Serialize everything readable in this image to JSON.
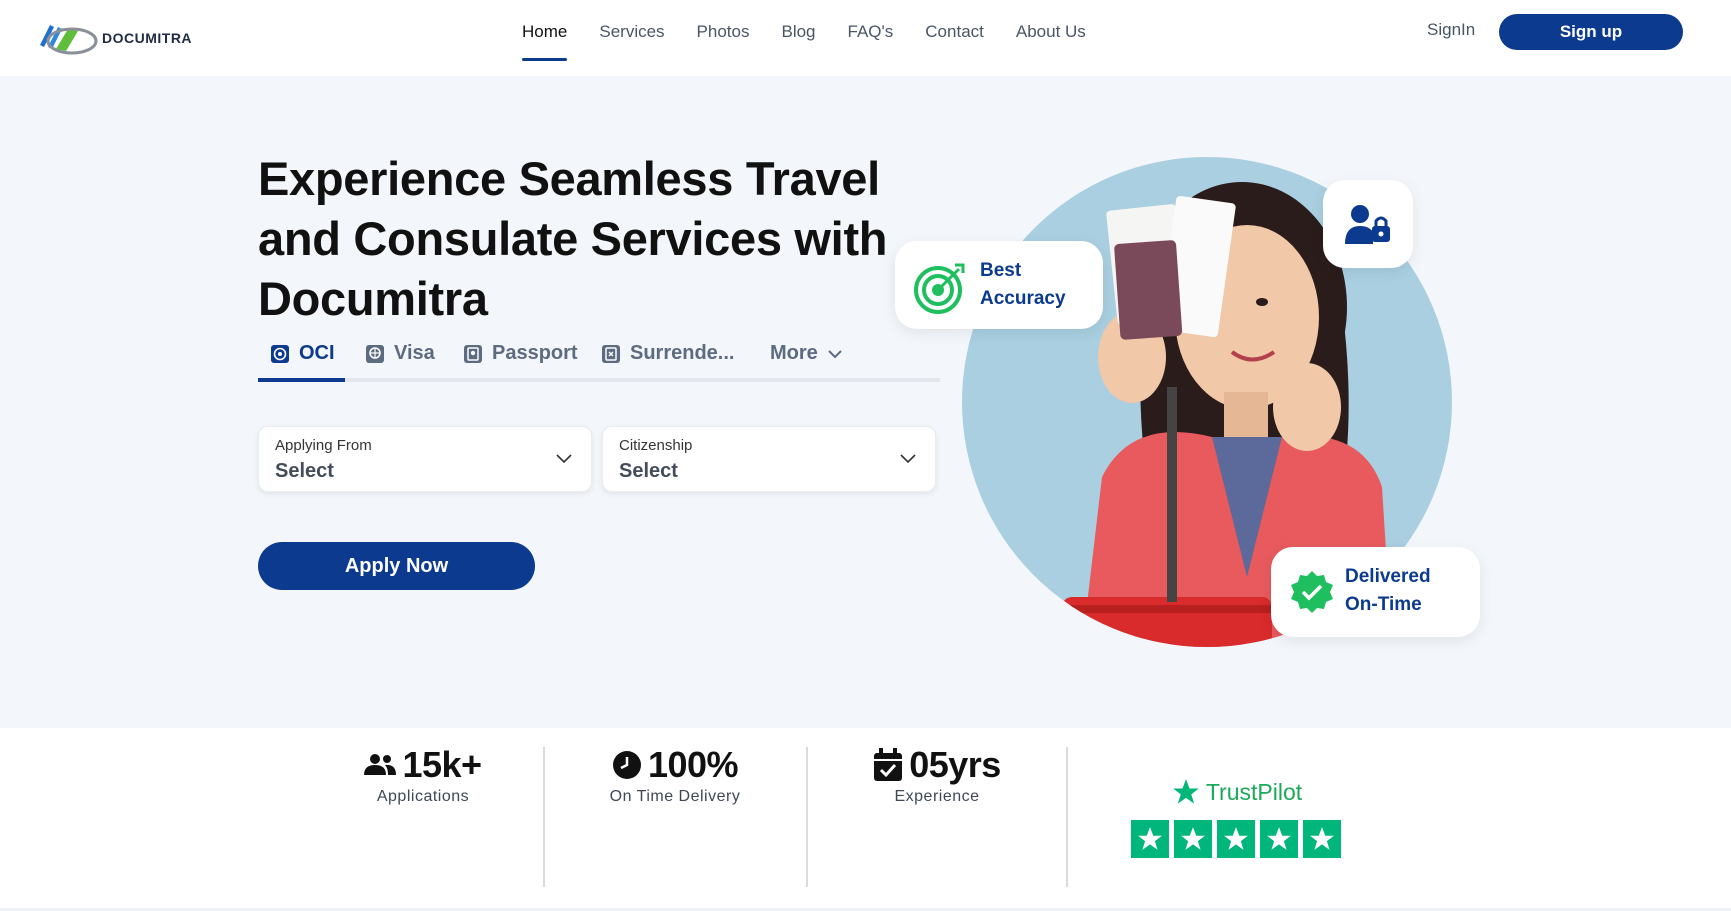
{
  "brand": {
    "name": "DOCUMITRA"
  },
  "nav": {
    "items": [
      "Home",
      "Services",
      "Photos",
      "Blog",
      "FAQ's",
      "Contact",
      "About Us"
    ],
    "active": "Home",
    "signin_label": "SignIn",
    "signup_label": "Sign up"
  },
  "hero": {
    "title": "Experience Seamless Travel and Consulate Services with Documitra",
    "tabs": [
      {
        "label": "OCI",
        "icon": "oci-icon"
      },
      {
        "label": "Visa",
        "icon": "visa-icon"
      },
      {
        "label": "Passport",
        "icon": "passport-icon"
      },
      {
        "label": "Surrende...",
        "icon": "surrender-icon"
      },
      {
        "label": "More",
        "icon": "chevron-down-icon"
      }
    ],
    "active_tab": "OCI",
    "applying_from": {
      "label": "Applying From",
      "value": "Select"
    },
    "citizenship": {
      "label": "Citizenship",
      "value": "Select"
    },
    "apply_label": "Apply Now",
    "badges": {
      "accuracy_line1": "Best",
      "accuracy_line2": "Accuracy",
      "delivered_line1": "Delivered",
      "delivered_line2": "On-Time"
    }
  },
  "stats": [
    {
      "value": "15k+",
      "label": "Applications",
      "icon": "users-icon"
    },
    {
      "value": "100%",
      "label": "On Time Delivery",
      "icon": "clock-icon"
    },
    {
      "value": "05yrs",
      "label": "Experience",
      "icon": "calendar-check-icon"
    }
  ],
  "trustpilot": {
    "label": "TrustPilot",
    "stars": 5
  },
  "colors": {
    "primary": "#0b3a8f",
    "accent_green": "#1fbf5f",
    "trust_green": "#00b67a",
    "hero_bg": "#f3f6fb"
  }
}
